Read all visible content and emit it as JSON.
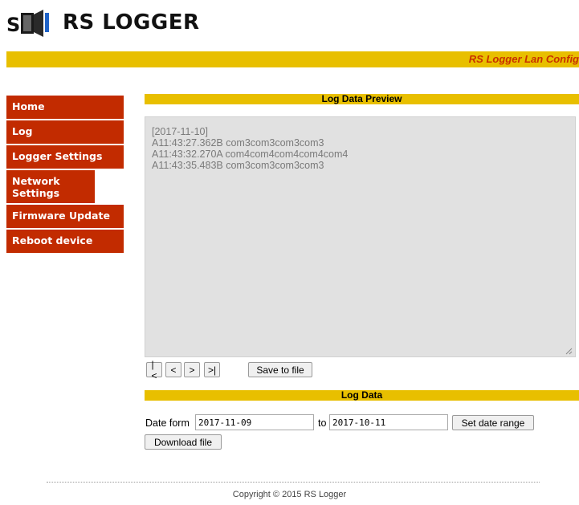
{
  "app": {
    "title": "RS LOGGER",
    "config_label": "RS Logger Lan Config"
  },
  "sidebar": {
    "items": [
      {
        "label": "Home"
      },
      {
        "label": "Log"
      },
      {
        "label": "Logger Settings"
      },
      {
        "label": "Network Settings"
      },
      {
        "label": "Firmware Update"
      },
      {
        "label": "Reboot device"
      }
    ]
  },
  "preview": {
    "title": "Log Data Preview",
    "lines": [
      "[2017-11-10]",
      "A11:43:27.362B com3com3com3com3",
      "A11:43:32.270A com4com4com4com4com4",
      "A11:43:35.483B com3com3com3com3"
    ],
    "buttons": {
      "first": "|<",
      "prev": "<",
      "next": ">",
      "last": ">|",
      "save": "Save to file"
    }
  },
  "logdata": {
    "title": "Log Data",
    "date_from_label": "Date form",
    "date_from": "2017-11-09",
    "to_label": "to",
    "date_to": "2017-10-11",
    "set_range": "Set date range",
    "download": "Download file"
  },
  "footer": {
    "copyright": "Copyright © 2015 RS Logger"
  },
  "colors": {
    "accent_bar": "#e8bf00",
    "nav_bg": "#c22b00",
    "config_text": "#c83200"
  }
}
